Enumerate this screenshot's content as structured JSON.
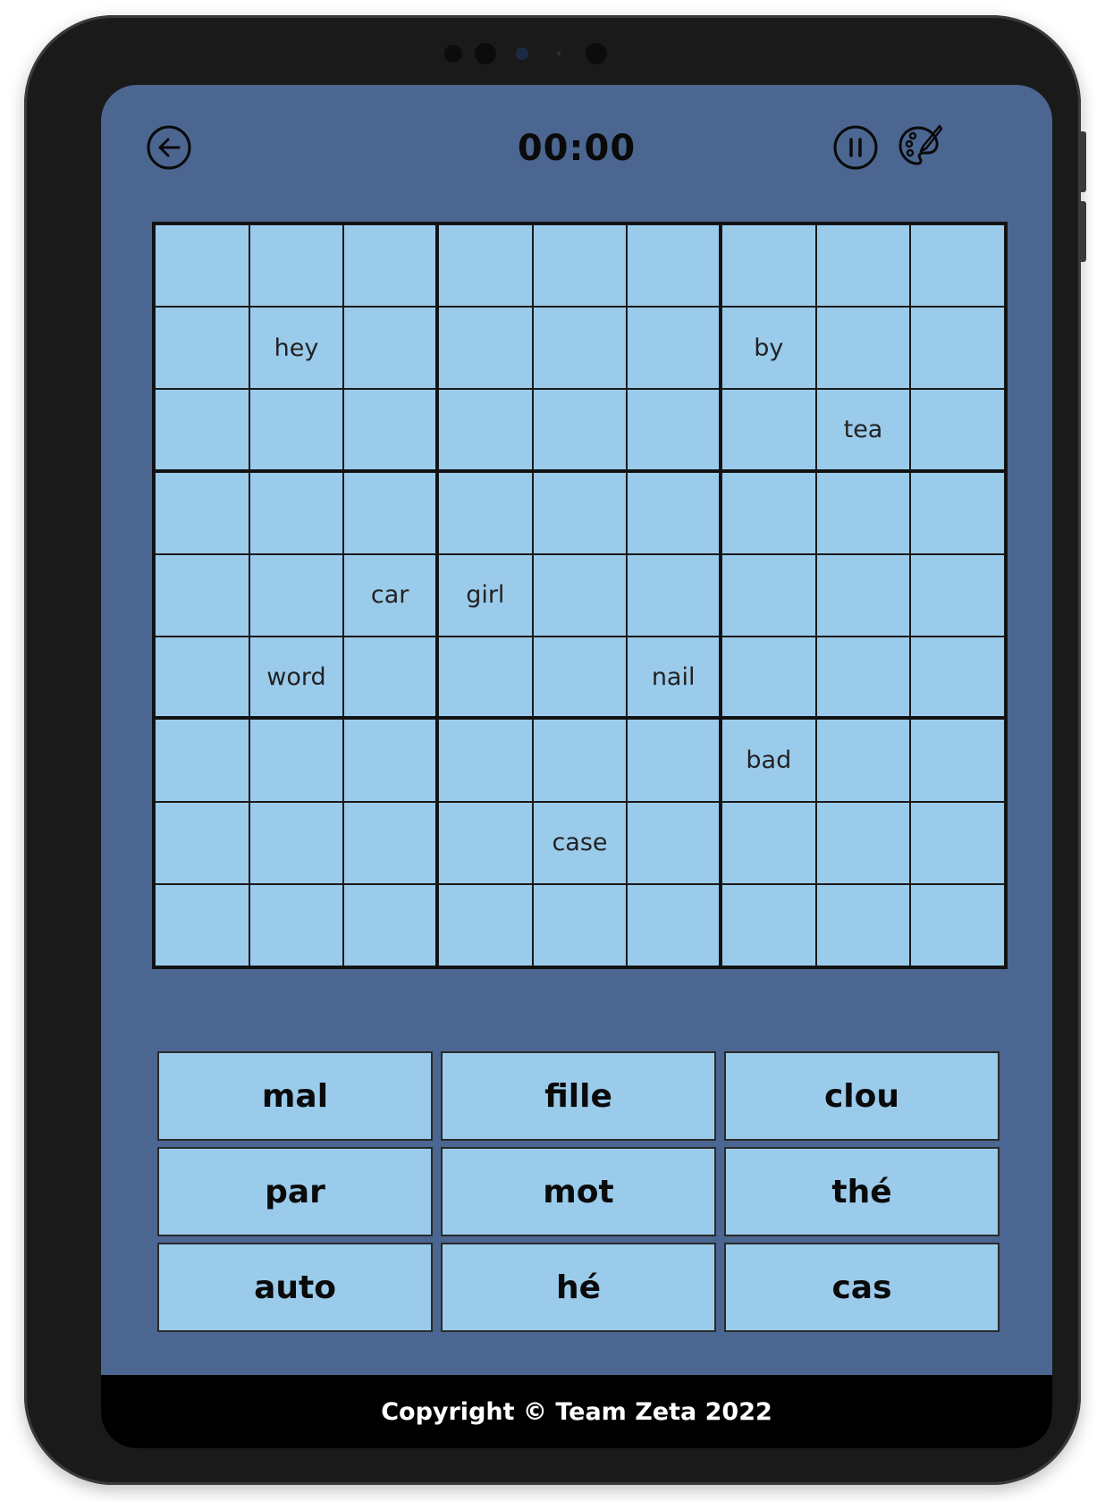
{
  "header": {
    "back_icon": "back-arrow-circle-icon",
    "timer": "00:00",
    "pause_icon": "pause-circle-icon",
    "theme_icon": "palette-icon"
  },
  "board": {
    "rows": 9,
    "cols": 9,
    "cells": [
      [
        "",
        "",
        "",
        "",
        "",
        "",
        "",
        "",
        ""
      ],
      [
        "",
        "hey",
        "",
        "",
        "",
        "",
        "by",
        "",
        ""
      ],
      [
        "",
        "",
        "",
        "",
        "",
        "",
        "",
        "tea",
        ""
      ],
      [
        "",
        "",
        "",
        "",
        "",
        "",
        "",
        "",
        ""
      ],
      [
        "",
        "",
        "car",
        "girl",
        "",
        "",
        "",
        "",
        ""
      ],
      [
        "",
        "word",
        "",
        "",
        "",
        "nail",
        "",
        "",
        ""
      ],
      [
        "",
        "",
        "",
        "",
        "",
        "",
        "bad",
        "",
        ""
      ],
      [
        "",
        "",
        "",
        "",
        "case",
        "",
        "",
        "",
        ""
      ],
      [
        "",
        "",
        "",
        "",
        "",
        "",
        "",
        "",
        ""
      ]
    ]
  },
  "word_bank": [
    [
      "mal",
      "fille",
      "clou"
    ],
    [
      "par",
      "mot",
      "thé"
    ],
    [
      "auto",
      "hé",
      "cas"
    ]
  ],
  "footer": {
    "copyright": "Copyright © Team Zeta 2022"
  },
  "colors": {
    "screen_bg": "#4b6690",
    "cell_bg": "#9bcbeb",
    "footer_bg": "#000000",
    "device_frame": "#1a1a1a"
  }
}
